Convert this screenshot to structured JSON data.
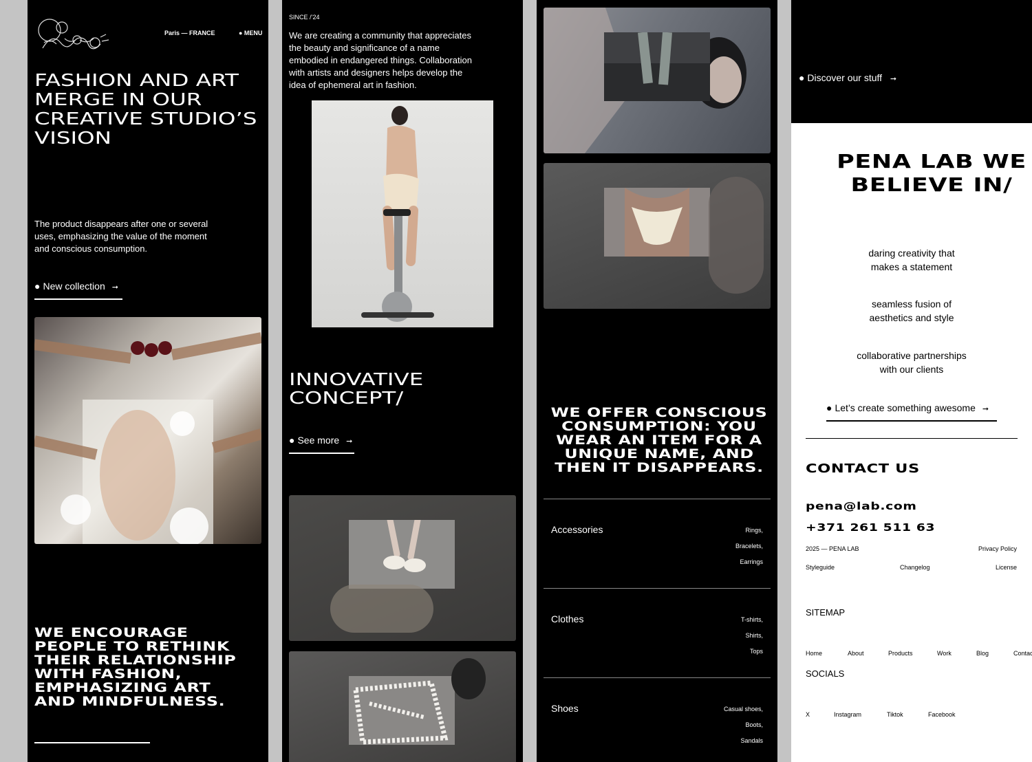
{
  "col1": {
    "location": "Paris — FRANCE",
    "menu": "● MENU",
    "headline": "FASHION AND ART MERGE IN OUR CREATIVE STUDIO’S VISION",
    "intro": "The product disappears after one or several uses, emphasizing the value of the moment and conscious consumption.",
    "cta": "New collection",
    "statement": "WE ENCOURAGE PEOPLE TO RETHINK THEIR RELATIONSHIP WITH FASHION, EMPHASIZING ART AND MINDFULNESS."
  },
  "col2": {
    "since": "SINCE /’24",
    "about": "We are creating a community that appreciates the beauty and significance of a name embodied in endangered things. Collaboration with artists and designers helps develop the idea of ephemeral art in fashion.",
    "concept_title": "INNOVATIVE CONCEPT/",
    "cta": "See more"
  },
  "col3": {
    "statement": "WE OFFER CONSCIOUS CONSUMPTION: YOU WEAR AN ITEM FOR A UNIQUE NAME, AND THEN IT DISAPPEARS.",
    "categories": [
      {
        "name": "Accessories",
        "items": [
          "Rings,",
          "Bracelets,",
          "Earrings"
        ]
      },
      {
        "name": "Clothes",
        "items": [
          "T-shirts,",
          "Shirts,",
          "Tops"
        ]
      },
      {
        "name": "Shoes",
        "items": [
          "Casual shoes,",
          "Boots,",
          "Sandals"
        ]
      }
    ]
  },
  "col4": {
    "discover": "Discover our stuff",
    "believe_title": "PENA LAB WE BELIEVE IN/",
    "beliefs": [
      "daring creativity that makes a statement",
      "seamless fusion of aesthetics and style",
      "collaborative partnerships with our clients"
    ],
    "cta": "Let’s create something awesome",
    "contact_title": "CONTACT US",
    "email": "pena@lab.com",
    "phone": "+371 261 511 63",
    "copyright": "2025 — PENA LAB",
    "privacy": "Privacy Policy",
    "styleguide": "Styleguide",
    "changelog": "Changelog",
    "license": "License",
    "sitemap_title": "SITEMAP",
    "sitemap": [
      "Home",
      "About",
      "Products",
      "Work",
      "Blog",
      "Contacts"
    ],
    "socials_title": "SOCIALS",
    "socials": [
      "X",
      "Instagram",
      "Tiktok",
      "Facebook"
    ]
  },
  "colors": {
    "background": "#c4c4c4",
    "dark": "#000000",
    "light": "#ffffff"
  },
  "icons": [
    "pena-lab-logo",
    "bullet-dot-icon",
    "arrow-right-icon"
  ]
}
